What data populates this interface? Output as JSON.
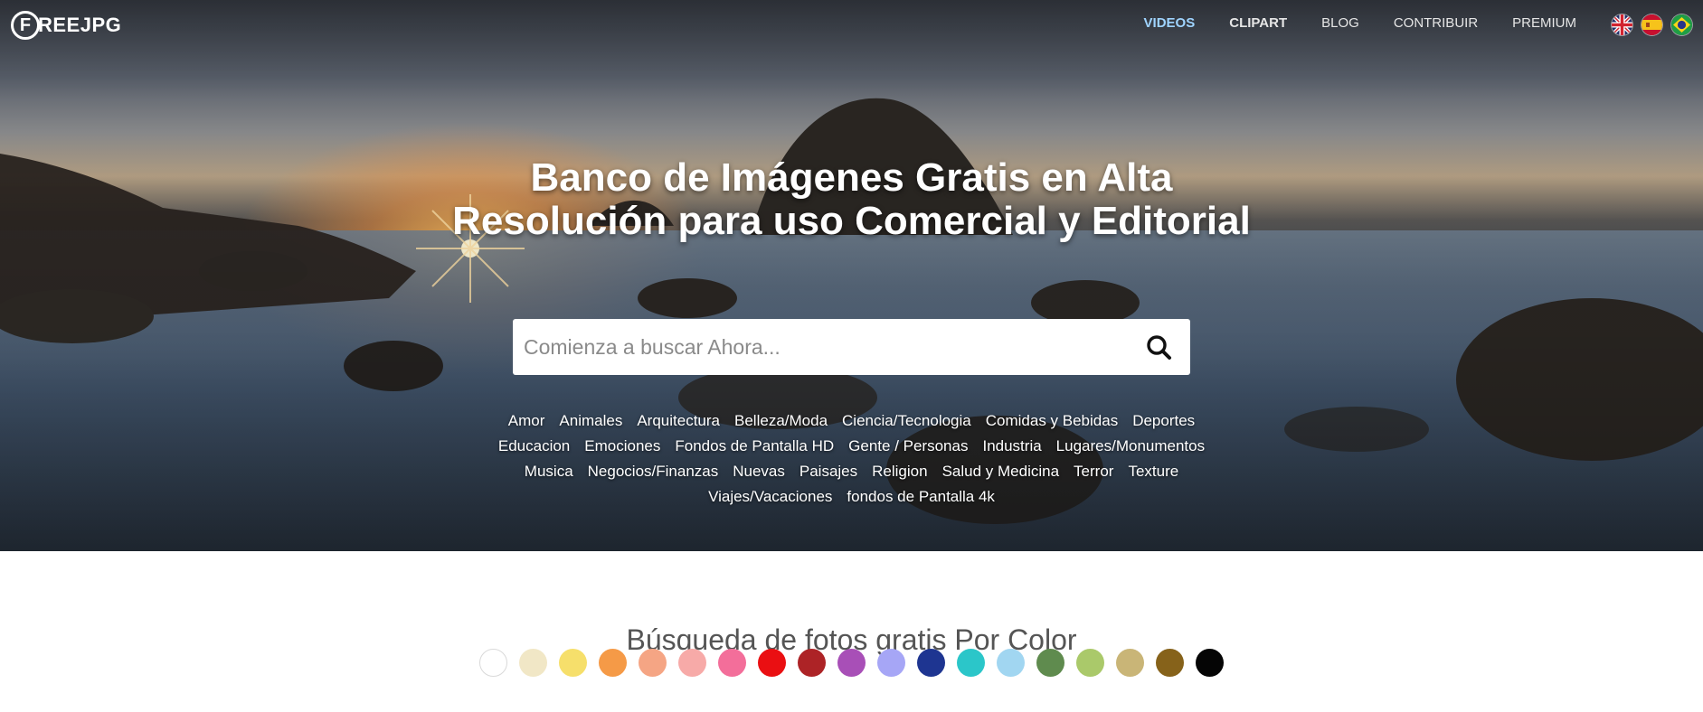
{
  "brand": {
    "logo_letter": "F",
    "logo_text": "REEJPG"
  },
  "nav": [
    {
      "label": "VIDEOS",
      "bold": true,
      "active": true
    },
    {
      "label": "CLIPART",
      "bold": true,
      "active": false
    },
    {
      "label": "BLOG",
      "bold": false,
      "active": false
    },
    {
      "label": "CONTRIBUIR",
      "bold": false,
      "active": false
    },
    {
      "label": "PREMIUM",
      "bold": false,
      "active": false
    }
  ],
  "languages": [
    "uk-flag-icon",
    "spain-flag-icon",
    "brazil-flag-icon"
  ],
  "hero": {
    "title_line1": "Banco de Imágenes Gratis en Alta",
    "title_line2": "Resolución para uso Comercial y Editorial"
  },
  "search": {
    "placeholder": "Comienza a buscar Ahora...",
    "icon": "search-icon"
  },
  "categories": [
    "Amor",
    "Animales",
    "Arquitectura",
    "Belleza/Moda",
    "Ciencia/Tecnologia",
    "Comidas y Bebidas",
    "Deportes",
    "Educacion",
    "Emociones",
    "Fondos de Pantalla HD",
    "Gente / Personas",
    "Industria",
    "Lugares/Monumentos",
    "Musica",
    "Negocios/Finanzas",
    "Nuevas",
    "Paisajes",
    "Religion",
    "Salud y Medicina",
    "Terror",
    "Texture",
    "Viajes/Vacaciones",
    "fondos de Pantalla 4k"
  ],
  "color_search": {
    "title": "Búsqueda de fotos gratis Por Color",
    "swatches": [
      "#ffffff",
      "#f1e7c6",
      "#f6df6b",
      "#f59a47",
      "#f5a584",
      "#f7aaa8",
      "#f36e9a",
      "#ea0f12",
      "#ad2326",
      "#a84fb7",
      "#a6a6f6",
      "#1e3591",
      "#2bc6c9",
      "#a1d6f1",
      "#5f8b4e",
      "#aac96a",
      "#c9b577",
      "#86621a",
      "#050505"
    ]
  }
}
